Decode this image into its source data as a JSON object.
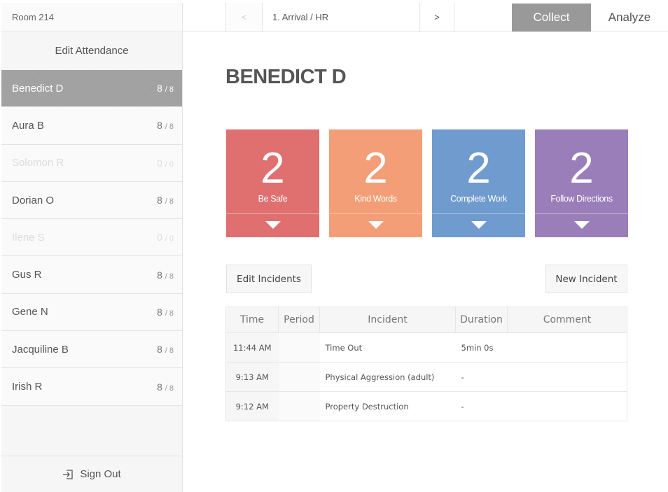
{
  "sidebar": {
    "room": "Room 214",
    "edit_attendance": "Edit Attendance",
    "students": [
      {
        "name": "Benedict D",
        "count": "8",
        "total": "8",
        "state": "active"
      },
      {
        "name": "Aura B",
        "count": "8",
        "total": "8",
        "state": "present"
      },
      {
        "name": "Solomon R",
        "count": "0",
        "total": "0",
        "state": "absent"
      },
      {
        "name": "Dorian O",
        "count": "8",
        "total": "8",
        "state": "present"
      },
      {
        "name": "Ilene S",
        "count": "0",
        "total": "0",
        "state": "absent"
      },
      {
        "name": "Gus R",
        "count": "8",
        "total": "8",
        "state": "present"
      },
      {
        "name": "Gene N",
        "count": "8",
        "total": "8",
        "state": "present"
      },
      {
        "name": "Jacquiline B",
        "count": "8",
        "total": "8",
        "state": "present"
      },
      {
        "name": "Irish R",
        "count": "8",
        "total": "8",
        "state": "present"
      }
    ],
    "sign_out": "Sign Out",
    "sign_out_icon": "sign-out-icon"
  },
  "topbar": {
    "prev": "<",
    "period": "1. Arrival / HR",
    "next": ">",
    "collect": "Collect",
    "analyze": "Analyze"
  },
  "main": {
    "student_title": "BENEDICT D",
    "tiles": [
      {
        "value": "2",
        "label": "Be Safe",
        "color": "#e06f6f"
      },
      {
        "value": "2",
        "label": "Kind Words",
        "color": "#f39e76"
      },
      {
        "value": "2",
        "label": "Complete Work",
        "color": "#6f9bce"
      },
      {
        "value": "2",
        "label": "Follow Directions",
        "color": "#9a7eb9"
      }
    ],
    "edit_incidents": "Edit Incidents",
    "new_incident": "New Incident",
    "table": {
      "headers": [
        "Time",
        "Period",
        "Incident",
        "Duration",
        "Comment"
      ],
      "rows": [
        [
          "11:44 AM",
          "",
          "Time Out",
          "5min 0s",
          ""
        ],
        [
          "9:13 AM",
          "",
          "Physical Aggression (adult)",
          "-",
          ""
        ],
        [
          "9:12 AM",
          "",
          "Property Destruction",
          "-",
          ""
        ]
      ]
    }
  }
}
